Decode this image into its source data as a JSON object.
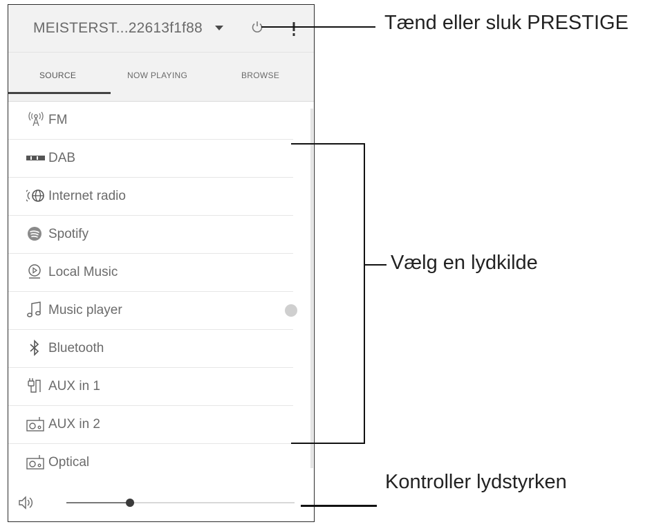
{
  "header": {
    "device_name": "MEISTERST...22613f1f88",
    "power_icon": "power-icon",
    "more_icon": "more-vertical-icon",
    "dropdown_icon": "chevron-down-icon"
  },
  "tabs": [
    {
      "label": "SOURCE",
      "selected": true
    },
    {
      "label": "NOW PLAYING",
      "selected": false
    },
    {
      "label": "BROWSE",
      "selected": false
    }
  ],
  "sources": [
    {
      "label": "FM",
      "icon": "fm-antenna-icon"
    },
    {
      "label": "DAB",
      "icon": "dab-icon"
    },
    {
      "label": "Internet radio",
      "icon": "internet-radio-icon"
    },
    {
      "label": "Spotify",
      "icon": "spotify-icon"
    },
    {
      "label": "Local Music",
      "icon": "local-music-icon"
    },
    {
      "label": "Music player",
      "icon": "music-note-icon"
    },
    {
      "label": "Bluetooth",
      "icon": "bluetooth-icon"
    },
    {
      "label": "AUX in 1",
      "icon": "aux-plug-icon"
    },
    {
      "label": "AUX in 2",
      "icon": "aux-device-icon"
    },
    {
      "label": "Optical",
      "icon": "optical-device-icon"
    }
  ],
  "volume": {
    "level": 0.28,
    "icon": "speaker-icon"
  },
  "annotations": {
    "power": "Tænd eller sluk PRESTIGE",
    "source": "Vælg en lydkilde",
    "volume": "Kontroller lydstyrken"
  }
}
